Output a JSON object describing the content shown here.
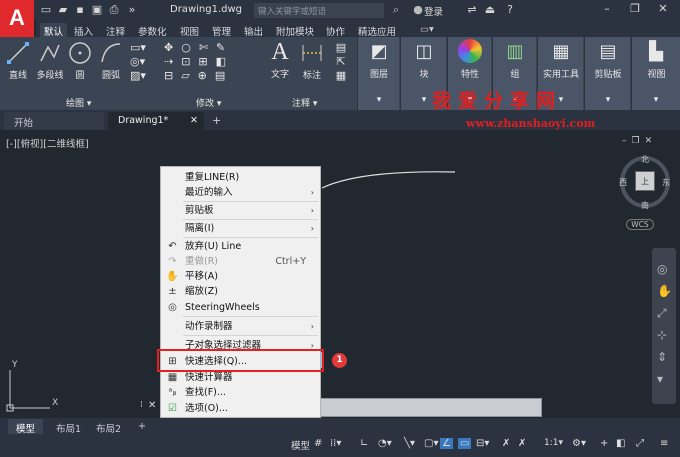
{
  "app": {
    "logo": "A",
    "doc_title": "Drawing1.dwg",
    "search_placeholder": "键入关键字或短语",
    "login": "登录"
  },
  "ribbon_tabs": [
    "默认",
    "插入",
    "注释",
    "参数化",
    "视图",
    "管理",
    "输出",
    "附加模块",
    "协作",
    "精选应用"
  ],
  "ribbon": {
    "draw_tools": [
      "直线",
      "多段线",
      "圆",
      "圆弧"
    ],
    "draw_panel": "绘图",
    "modify_panel": "修改",
    "annot_tools": [
      "文字",
      "标注"
    ],
    "annot_panel": "注释",
    "blocks": [
      "图层",
      "块",
      "特性",
      "组",
      "实用工具",
      "剪贴板",
      "视图"
    ]
  },
  "file_tabs": [
    "开始",
    "Drawing1*"
  ],
  "viewport_label": "[-][俯视][二维线框]",
  "watermark": {
    "line1": "我爱分享网",
    "line2": "www.zhanshaoyi.com"
  },
  "compass": {
    "n": "北",
    "s": "南",
    "w": "西",
    "e": "东",
    "center": "上",
    "wcs": "WCS"
  },
  "ucs": {
    "y": "Y",
    "x": "X"
  },
  "context_menu": [
    {
      "label": "重复LINE(R)"
    },
    {
      "label": "最近的输入",
      "arrow": "›"
    },
    {
      "label": "剪贴板",
      "arrow": "›"
    },
    {
      "label": "隔离(I)",
      "arrow": "›"
    },
    {
      "label": "放弃(U) Line"
    },
    {
      "label": "重做(R)",
      "shortcut": "Ctrl+Y"
    },
    {
      "label": "平移(A)"
    },
    {
      "label": "缩放(Z)"
    },
    {
      "label": "SteeringWheels"
    },
    {
      "label": "动作录制器",
      "arrow": "›"
    },
    {
      "label": "子对象选择过滤器",
      "arrow": "›"
    },
    {
      "label": "快速选择(Q)..."
    },
    {
      "label": "快速计算器"
    },
    {
      "label": "查找(F)..."
    },
    {
      "label": "选项(O)..."
    }
  ],
  "badge": "1",
  "layout_tabs": [
    "模型",
    "布局1",
    "布局2"
  ],
  "status": {
    "model": "模型",
    "scale": "1:1"
  }
}
